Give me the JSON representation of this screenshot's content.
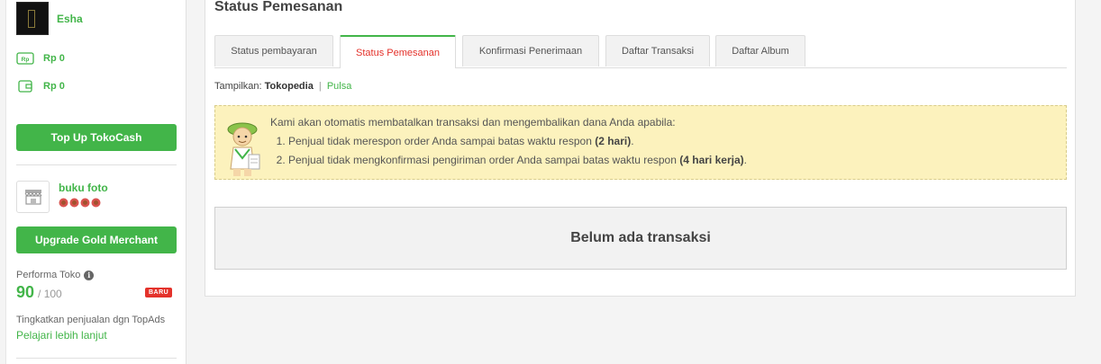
{
  "sidebar": {
    "user": {
      "name": "Esha"
    },
    "balances": [
      {
        "icon": "tokocash-icon",
        "value": "Rp 0"
      },
      {
        "icon": "wallet-icon",
        "value": "Rp 0"
      }
    ],
    "topup_label": "Top Up TokoCash",
    "shop": {
      "name": "buku foto",
      "badge_count": 4
    },
    "upgrade_label": "Upgrade Gold Merchant",
    "performance": {
      "label": "Performa Toko",
      "score": "90",
      "max": "/ 100",
      "badge": "BARU"
    },
    "topads_text": "Tingkatkan penjualan dgn TopAds",
    "learn_more": "Pelajari lebih lanjut"
  },
  "main": {
    "title": "Status Pemesanan",
    "tabs": [
      {
        "label": "Status pembayaran",
        "active": false
      },
      {
        "label": "Status Pemesanan",
        "active": true
      },
      {
        "label": "Konfirmasi Penerimaan",
        "active": false
      },
      {
        "label": "Daftar Transaksi",
        "active": false
      },
      {
        "label": "Daftar Album",
        "active": false
      }
    ],
    "filter": {
      "label": "Tampilkan:",
      "selected": "Tokopedia",
      "separator": "|",
      "other": "Pulsa"
    },
    "notice": {
      "intro": "Kami akan otomatis membatalkan transaksi dan mengembalikan dana Anda apabila:",
      "items": [
        {
          "text": "Penjual tidak merespon order Anda sampai batas waktu respon ",
          "bold": "(2 hari)",
          "end": "."
        },
        {
          "text": "Penjual tidak mengkonfirmasi pengiriman order Anda sampai batas waktu respon ",
          "bold": "(4 hari kerja)",
          "end": "."
        }
      ]
    },
    "empty_message": "Belum ada transaksi"
  },
  "colors": {
    "brand_green": "#42b549",
    "active_tab_text": "#e4322b",
    "notice_bg": "#fcf2bd"
  }
}
